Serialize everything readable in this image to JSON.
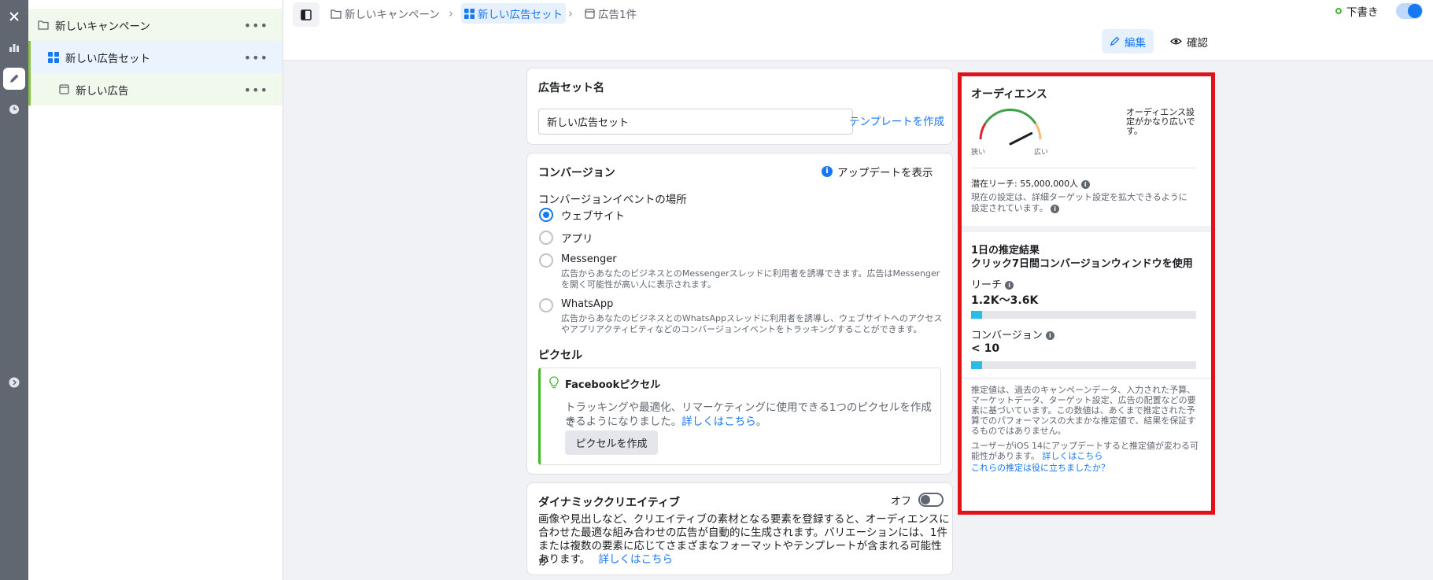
{
  "breadcrumbs": [
    {
      "label": "新しいキャンペーン"
    },
    {
      "label": "新しい広告セット"
    },
    {
      "label": "広告1件"
    }
  ],
  "status": {
    "draft_label": "下書き",
    "toggle_on": true
  },
  "tabs": {
    "edit": "編集",
    "review": "確認"
  },
  "tree": [
    {
      "label": "新しいキャンペーン"
    },
    {
      "label": "新しい広告セット"
    },
    {
      "label": "新しい広告"
    }
  ],
  "adset_name": {
    "title": "広告セット名",
    "value": "新しい広告セット",
    "template_link": "テンプレートを作成"
  },
  "conversion": {
    "title": "コンバージョン",
    "update_label": "アップデートを表示",
    "location_label": "コンバージョンイベントの場所",
    "options": [
      {
        "label": "ウェブサイト",
        "selected": true,
        "desc": ""
      },
      {
        "label": "アプリ",
        "selected": false,
        "desc": ""
      },
      {
        "label": "Messenger",
        "selected": false,
        "desc1": "広告からあなたのビジネスとのMessengerスレッドに利用者を誘導できます。広告はMessenger",
        "desc2": "を開く可能性が高い人に表示されます。"
      },
      {
        "label": "WhatsApp",
        "selected": false,
        "desc1": "広告からあなたのビジネスとのWhatsAppスレッドに利用者を誘導し、ウェブサイトへのアクセス",
        "desc2": "やアプリアクティビティなどのコンバージョンイベントをトラッキングすることができます。"
      }
    ],
    "pixel_title": "ピクセル",
    "pixel_box": {
      "heading": "Facebookピクセル",
      "text1": "トラッキングや最適化、リマーケティングに使用できる1つのピクセルを作成で",
      "text2": "きるようになりました。",
      "link": "詳しくはこちら",
      "period": "。",
      "button": "ピクセルを作成"
    }
  },
  "dynamic": {
    "title": "ダイナミッククリエイティブ",
    "toggle_label": "オフ",
    "lines": [
      "画像や見出しなど、クリエイティブの素材となる要素を登録すると、オーディエンスに",
      "合わせた最適な組み合わせの広告が自動的に生成されます。バリエーションには、1件",
      "または複数の要素に応じてさまざまなフォーマットやテンプレートが含まれる可能性が"
    ],
    "last_line": "あります。",
    "link": "詳しくはこちら"
  },
  "audience": {
    "title": "オーディエンス",
    "gauge_left": "狭い",
    "gauge_right": "広い",
    "gauge_level": 0.85,
    "gauge_text": [
      "オーディエンス設",
      "定がかなり広いで",
      "す。"
    ],
    "reach_line": "潜在リーチ: 55,000,000人",
    "reach_desc": [
      "現在の設定は、詳細ターゲット設定を拡大できるように",
      "設定されています。"
    ]
  },
  "estimates": {
    "title": "1日の推定結果",
    "subtitle": "クリック7日間コンバージョンウィンドウを使用",
    "reach_label": "リーチ",
    "reach_value": "1.2K〜3.6K",
    "reach_fill": 0.05,
    "conv_label": "コンバージョン",
    "conv_value": "< 10",
    "conv_fill": 0.05,
    "disclaimer": [
      "推定値は、過去のキャンペーンデータ、入力された予算、",
      "マーケットデータ、ターゲット設定、広告の配置などの要",
      "素に基づいています。この数値は、あくまで推定された予",
      "算でのパフォーマンスの大まかな推定値で、結果を保証す",
      "るものではありません。"
    ],
    "ios_text1": "ユーザーがiOS 14にアップデートすると推定値が変わる可",
    "ios_text2": "能性があります。",
    "ios_link": "詳しくはこちら",
    "feedback_link": "これらの推定は役に立ちましたか？"
  },
  "colors": {
    "accent": "#1877f2",
    "highlight_border": "#e0131a",
    "bar_fill": "#2abbe8"
  }
}
